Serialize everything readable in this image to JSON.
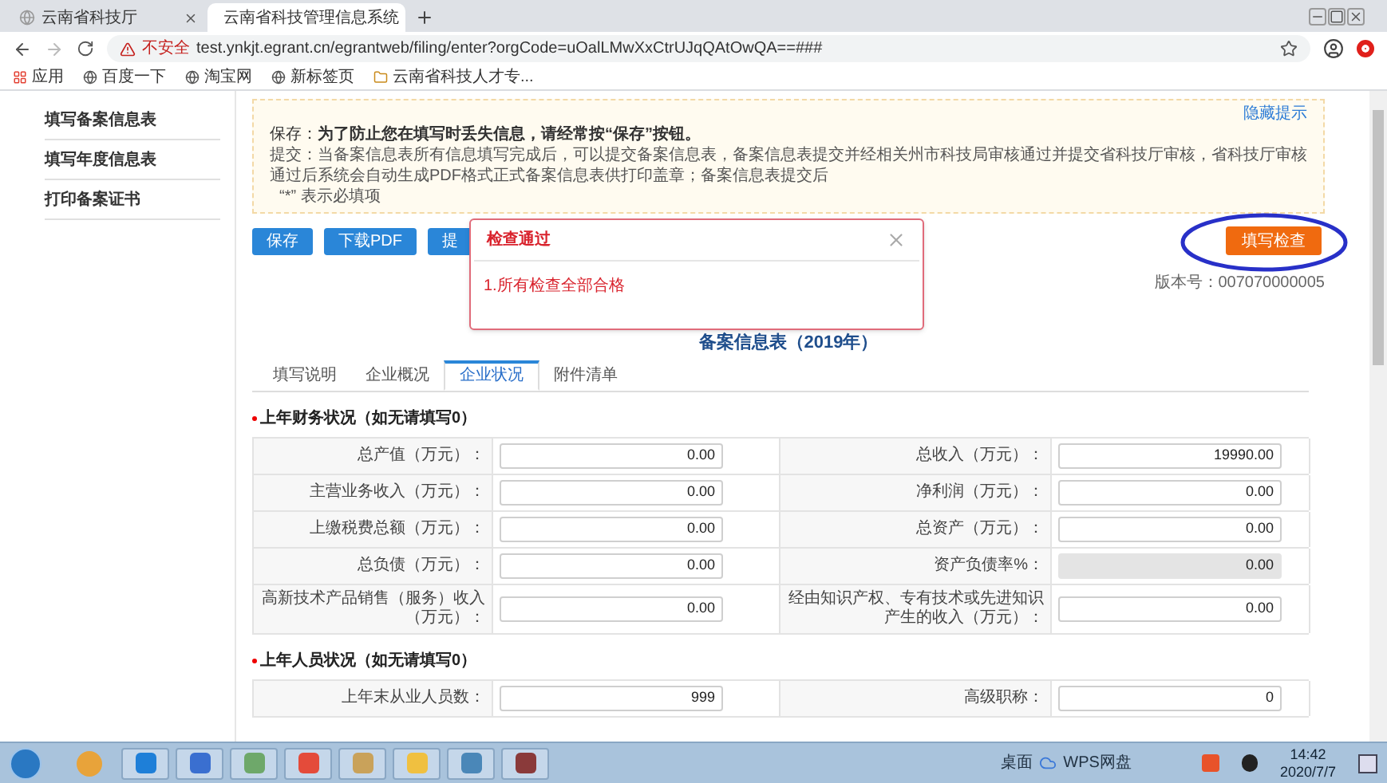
{
  "browser": {
    "tabs": [
      {
        "title": "云南省科技厅",
        "selected": false
      },
      {
        "title": "云南省科技管理信息系统",
        "selected": true
      }
    ],
    "security": "不安全",
    "url": "test.ynkjt.egrant.cn/egrantweb/filing/enter?orgCode=uOalLMwXxCtrUJqQAtOwQA==###",
    "bookmarks": [
      {
        "kind": "apps",
        "label": "应用"
      },
      {
        "kind": "site",
        "label": "百度一下"
      },
      {
        "kind": "site",
        "label": "淘宝网"
      },
      {
        "kind": "site",
        "label": "新标签页"
      },
      {
        "kind": "folder",
        "label": "云南省科技人才专..."
      }
    ]
  },
  "sidebar": {
    "items": [
      {
        "label": "填写备案信息表"
      },
      {
        "label": "填写年度信息表"
      },
      {
        "label": "打印备案证书"
      }
    ]
  },
  "notice": {
    "hide_link": "隐藏提示",
    "save": "保存：**为了防止您在填写时丢失信息，请经常按“保存”按钮。**",
    "submit": "提交：当备案信息表所有信息填写完成后，可以提交备案信息表，备案信息表提交并经相关州市科技局审核通过并提交省科技厅审核，省科技厅审核通过后系统会自动生成PDF格式正式备案信息表供打印盖章；备案信息表提交后",
    "required": "“*” 表示必填项"
  },
  "actions": {
    "buttons": [
      "保存",
      "下载PDF",
      "提"
    ],
    "check_button": "填写检查",
    "version": "版本号：007070000005"
  },
  "form": {
    "title": "备案信息表（2019年）",
    "tabs": [
      {
        "label": "填写说明",
        "selected": false
      },
      {
        "label": "企业概况",
        "selected": false
      },
      {
        "label": "企业状况",
        "selected": true
      },
      {
        "label": "附件清单",
        "selected": false
      }
    ],
    "sections": [
      {
        "title": "上年财务状况（如无请填写0）",
        "required": true,
        "rows": [
          [
            {
              "label": "总产值（万元）：",
              "value": "0.00",
              "disabled": false
            },
            {
              "label": "总收入（万元）：",
              "value": "19990.00",
              "disabled": false
            }
          ],
          [
            {
              "label": "主营业务收入（万元）：",
              "value": "0.00",
              "disabled": false
            },
            {
              "label": "净利润（万元）：",
              "value": "0.00",
              "disabled": false
            }
          ],
          [
            {
              "label": "上缴税费总额（万元）：",
              "value": "0.00",
              "disabled": false
            },
            {
              "label": "总资产（万元）：",
              "value": "0.00",
              "disabled": false
            }
          ],
          [
            {
              "label": "总负债（万元）：",
              "value": "0.00",
              "disabled": false
            },
            {
              "label": "资产负债率%：",
              "value": "0.00",
              "disabled": true
            }
          ],
          [
            {
              "label": "高新技术产品销售（服务）收入（万元）：",
              "value": "0.00",
              "disabled": false
            },
            {
              "label": "经由知识产权、专有技术或先进知识产生的收入（万元）：",
              "value": "0.00",
              "disabled": false
            }
          ]
        ]
      },
      {
        "title": "上年人员状况（如无请填写0）",
        "required": true,
        "rows": [
          [
            {
              "label": "上年末从业人员数：",
              "value": "999",
              "disabled": false
            },
            {
              "label": "高级职称：",
              "value": "0",
              "disabled": false
            }
          ]
        ]
      }
    ]
  },
  "modal": {
    "title": "检查通过",
    "message": "1.所有检查全部合格"
  },
  "taskbar": {
    "desktop": "桌面",
    "cloud": "WPS网盘",
    "time": "14:42",
    "date": "2020/7/7"
  }
}
